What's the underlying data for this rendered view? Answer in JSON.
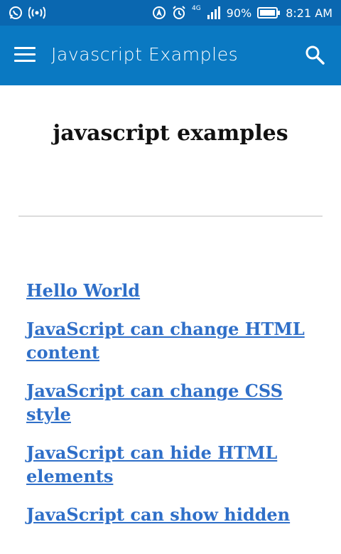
{
  "status_bar": {
    "battery": "90%",
    "time": "8:21 AM",
    "network": "4G"
  },
  "app_bar": {
    "title": "Javascript Examples"
  },
  "page": {
    "heading": "javascript examples"
  },
  "links": [
    {
      "label": "Hello World"
    },
    {
      "label": "JavaScript can change HTML content"
    },
    {
      "label": "JavaScript can change CSS style"
    },
    {
      "label": "JavaScript can hide HTML elements"
    },
    {
      "label": "JavaScript can show hidden"
    }
  ],
  "colors": {
    "status_bar": "#0a67b0",
    "app_bar": "#0a79c2",
    "link": "#2f6fc8",
    "divider": "#dcdcdc"
  }
}
